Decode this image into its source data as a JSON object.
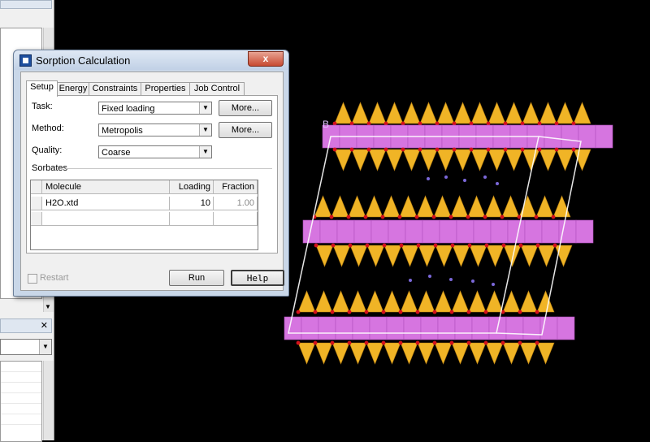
{
  "dialog": {
    "title": "Sorption Calculation",
    "close_label": "x"
  },
  "tabs": [
    {
      "label": "Setup",
      "active": true
    },
    {
      "label": "Energy",
      "active": false
    },
    {
      "label": "Constraints",
      "active": false
    },
    {
      "label": "Properties",
      "active": false
    },
    {
      "label": "Job Control",
      "active": false
    }
  ],
  "setup": {
    "task": {
      "label": "Task:",
      "value": "Fixed loading",
      "more_label": "More..."
    },
    "method": {
      "label": "Method:",
      "value": "Metropolis",
      "more_label": "More..."
    },
    "quality": {
      "label": "Quality:",
      "value": "Coarse"
    },
    "sorbates_label": "Sorbates",
    "table": {
      "columns": [
        "Molecule",
        "Loading",
        "Fraction"
      ],
      "rows": [
        {
          "molecule": "H2O.xtd",
          "loading": "10",
          "fraction": "1.00"
        }
      ]
    }
  },
  "footer": {
    "restart_label": "Restart",
    "run_label": "Run",
    "help_label": "Help"
  },
  "viewer": {
    "axis_label": "B",
    "colors": {
      "background": "#000000",
      "tetrahedra": "#f0b426",
      "octahedra": "#e27cec",
      "oxygen": "#d4111b",
      "cell": "#ffffff",
      "water": "#7b68d9"
    }
  }
}
